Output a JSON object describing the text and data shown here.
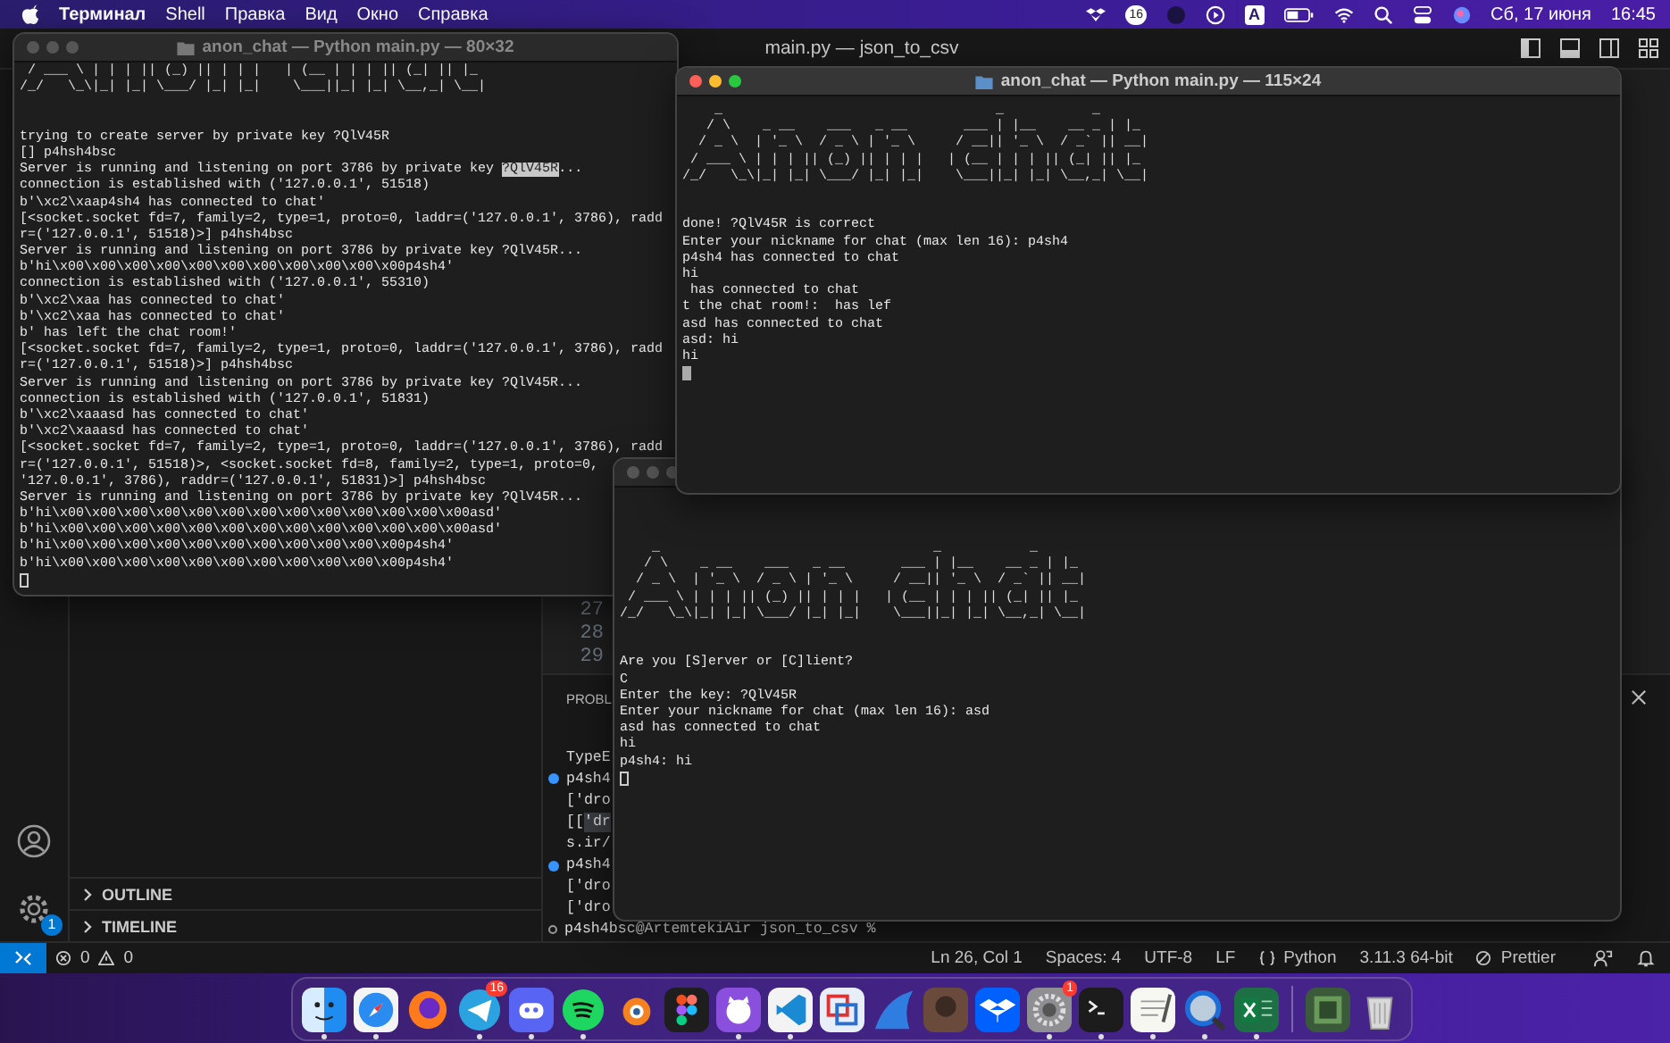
{
  "menu_bar": {
    "app_name": "Терминал",
    "menus": [
      "Shell",
      "Правка",
      "Вид",
      "Окно",
      "Справка"
    ],
    "tray_count": "16",
    "input_source": "A",
    "date": "Сб, 17 июня",
    "time": "16:45"
  },
  "editor": {
    "title": "main.py — json_to_csv",
    "line_numbers": [
      "27",
      "28",
      "29"
    ],
    "panel_tab": "PROBL",
    "panel_lines": [
      {
        "kind": "output",
        "segments": [
          {
            "text": "TypeE",
            "selected": false
          }
        ]
      },
      {
        "kind": "command",
        "segments": [
          {
            "text": "p4sh4",
            "selected": false
          }
        ]
      },
      {
        "kind": "output",
        "segments": [
          {
            "text": "['dro",
            "selected": false
          }
        ]
      },
      {
        "kind": "output",
        "segments": [
          {
            "text": "[[",
            "selected": false
          },
          {
            "text": "'dr",
            "selected": true
          }
        ]
      },
      {
        "kind": "output",
        "segments": [
          {
            "text": "s.ir/",
            "selected": false
          }
        ]
      },
      {
        "kind": "command",
        "segments": [
          {
            "text": "p4sh4",
            "selected": false
          }
        ]
      },
      {
        "kind": "output",
        "segments": [
          {
            "text": "['dro",
            "selected": false
          }
        ]
      },
      {
        "kind": "output",
        "segments": [
          {
            "text": "['dro",
            "selected": false
          }
        ]
      },
      {
        "kind": "prompt",
        "segments": [
          {
            "text": "p4sh4bsc@ArtemtekiAir json_to_csv %",
            "selected": false
          }
        ]
      }
    ],
    "sidebar_sections": [
      {
        "label": "OUTLINE",
        "expanded": false
      },
      {
        "label": "TIMELINE",
        "expanded": false
      }
    ],
    "settings_badge": "1"
  },
  "status_bar": {
    "errors": "0",
    "warnings": "0",
    "items": [
      "Ln 26, Col 1",
      "Spaces: 4",
      "UTF-8",
      "LF"
    ],
    "language": "Python",
    "interpreter": "3.11.3 64-bit",
    "formatter": "Prettier"
  },
  "terminals": [
    {
      "title": "anon_chat — Python main.py — 80×32",
      "active": false,
      "cursor_filled": false,
      "banner": [
        " / ___ \\ | | | || (_) || | | |   | (__ | | | || (_| || |_ ",
        "/_/   \\_\\|_| |_| \\___/ |_| |_|    \\___||_| |_| \\__,_| \\__|"
      ],
      "lines": [
        "trying to create server by private key ?QlV45R",
        "[] p4hsh4bsc",
        {
          "segments": [
            {
              "text": "Server is running and listening on port 3786 by private key ",
              "selected": false
            },
            {
              "text": "?QlV45R",
              "selected": true
            },
            {
              "text": "...",
              "selected": false
            }
          ]
        },
        "connection is established with ('127.0.0.1', 51518)",
        "b'\\xc2\\xaap4sh4 has connected to chat'",
        "[<socket.socket fd=7, family=2, type=1, proto=0, laddr=('127.0.0.1', 3786), radd",
        "r=('127.0.0.1', 51518)>] p4hsh4bsc",
        "Server is running and listening on port 3786 by private key ?QlV45R...",
        "b'hi\\x00\\x00\\x00\\x00\\x00\\x00\\x00\\x00\\x00\\x00\\x00p4sh4'",
        "connection is established with ('127.0.0.1', 55310)",
        "b'\\xc2\\xaa has connected to chat'",
        "b'\\xc2\\xaa has connected to chat'",
        "b' has left the chat room!'",
        "[<socket.socket fd=7, family=2, type=1, proto=0, laddr=('127.0.0.1', 3786), radd",
        "r=('127.0.0.1', 51518)>] p4hsh4bsc",
        "Server is running and listening on port 3786 by private key ?QlV45R...",
        "connection is established with ('127.0.0.1', 51831)",
        "b'\\xc2\\xaaasd has connected to chat'",
        "b'\\xc2\\xaaasd has connected to chat'",
        "[<socket.socket fd=7, family=2, type=1, proto=0, laddr=('127.0.0.1', 3786), radd",
        "r=('127.0.0.1', 51518)>, <socket.socket fd=8, family=2, type=1, proto=0,",
        "'127.0.0.1', 3786), raddr=('127.0.0.1', 51831)>] p4hsh4bsc",
        "Server is running and listening on port 3786 by private key ?QlV45R...",
        "b'hi\\x00\\x00\\x00\\x00\\x00\\x00\\x00\\x00\\x00\\x00\\x00\\x00\\x00asd'",
        "b'hi\\x00\\x00\\x00\\x00\\x00\\x00\\x00\\x00\\x00\\x00\\x00\\x00\\x00asd'",
        "b'hi\\x00\\x00\\x00\\x00\\x00\\x00\\x00\\x00\\x00\\x00\\x00p4sh4'",
        "b'hi\\x00\\x00\\x00\\x00\\x00\\x00\\x00\\x00\\x00\\x00\\x00p4sh4'"
      ]
    },
    {
      "active": false,
      "cursor_filled": false,
      "banner": [
        "    _                                  _           _   ",
        "   / \\    _ __    ___   _ __       ___ | |__    __ _ | |_ ",
        "  / _ \\  | '_ \\  / _ \\ | '_ \\     / __|| '_ \\  / _` || __|",
        " / ___ \\ | | | || (_) || | | |   | (__ | | | || (_| || |_ ",
        "/_/   \\_\\|_| |_| \\___/ |_| |_|    \\___||_| |_| \\__,_| \\__|"
      ],
      "lines": [
        "Are you [S]erver or [C]lient?",
        "C",
        "Enter the key: ?QlV45R",
        "Enter your nickname for chat (max len 16): asd",
        "asd has connected to chat",
        "hi",
        "p4sh4: hi"
      ]
    },
    {
      "title": "anon_chat — Python main.py — 115×24",
      "active": true,
      "cursor_filled": true,
      "banner": [
        "    _                                  _           _   ",
        "   / \\    _ __    ___   _ __       ___ | |__    __ _ | |_ ",
        "  / _ \\  | '_ \\  / _ \\ | '_ \\     / __|| '_ \\  / _` || __|",
        " / ___ \\ | | | || (_) || | | |   | (__ | | | || (_| || |_ ",
        "/_/   \\_\\|_| |_| \\___/ |_| |_|    \\___||_| |_| \\__,_| \\__|"
      ],
      "lines": [
        "done! ?QlV45R is correct",
        "Enter your nickname for chat (max len 16): p4sh4",
        "p4sh4 has connected to chat",
        "hi",
        " has connected to chat",
        "t the chat room!:  has lef",
        "asd has connected to chat",
        "asd: hi",
        "hi"
      ]
    }
  ],
  "dock": [
    {
      "running": true
    },
    {
      "running": true
    },
    {
      "running": false
    },
    {
      "running": true,
      "badge": "16"
    },
    {
      "running": true
    },
    {
      "running": true
    },
    {
      "running": false
    },
    {
      "running": false
    },
    {
      "running": true
    },
    {
      "running": true
    },
    {
      "running": false
    },
    {
      "running": false
    },
    {
      "running": false
    },
    {
      "running": false
    },
    {
      "running": true,
      "badge": "1"
    },
    {
      "running": true
    },
    {
      "running": true
    },
    {
      "running": true
    },
    {
      "running": true
    },
    {
      "running": false
    },
    {
      "running": false
    }
  ]
}
